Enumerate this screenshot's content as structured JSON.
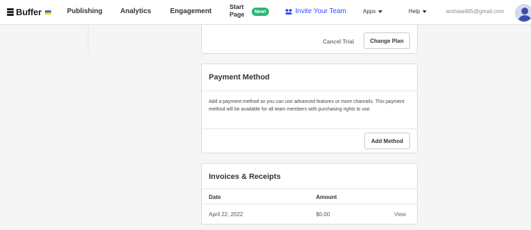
{
  "nav": {
    "brand": "Buffer",
    "items": [
      "Publishing",
      "Analytics",
      "Engagement"
    ],
    "start_page_line1": "Start",
    "start_page_line2": "Page",
    "new_badge": "New!",
    "invite": "Invite Your Team",
    "apps": "Apps",
    "help": "Help",
    "email": "arshiaa465@gmail.com",
    "accent_color": "#2c4bff",
    "badge_color": "#2bb673"
  },
  "plan_card": {
    "cancel_trial": "Cancel Trial",
    "change_plan": "Change Plan"
  },
  "payment_card": {
    "title": "Payment Method",
    "description": "Add a payment method so you can use advanced features or more channels. This payment method will be available for all team members with purchasing rights to use.",
    "add_method": "Add Method"
  },
  "invoices_card": {
    "title": "Invoices & Receipts",
    "columns": [
      "Date",
      "Amount"
    ],
    "rows": [
      {
        "date": "April 22, 2022",
        "amount": "$0.00",
        "action": "View"
      }
    ]
  }
}
